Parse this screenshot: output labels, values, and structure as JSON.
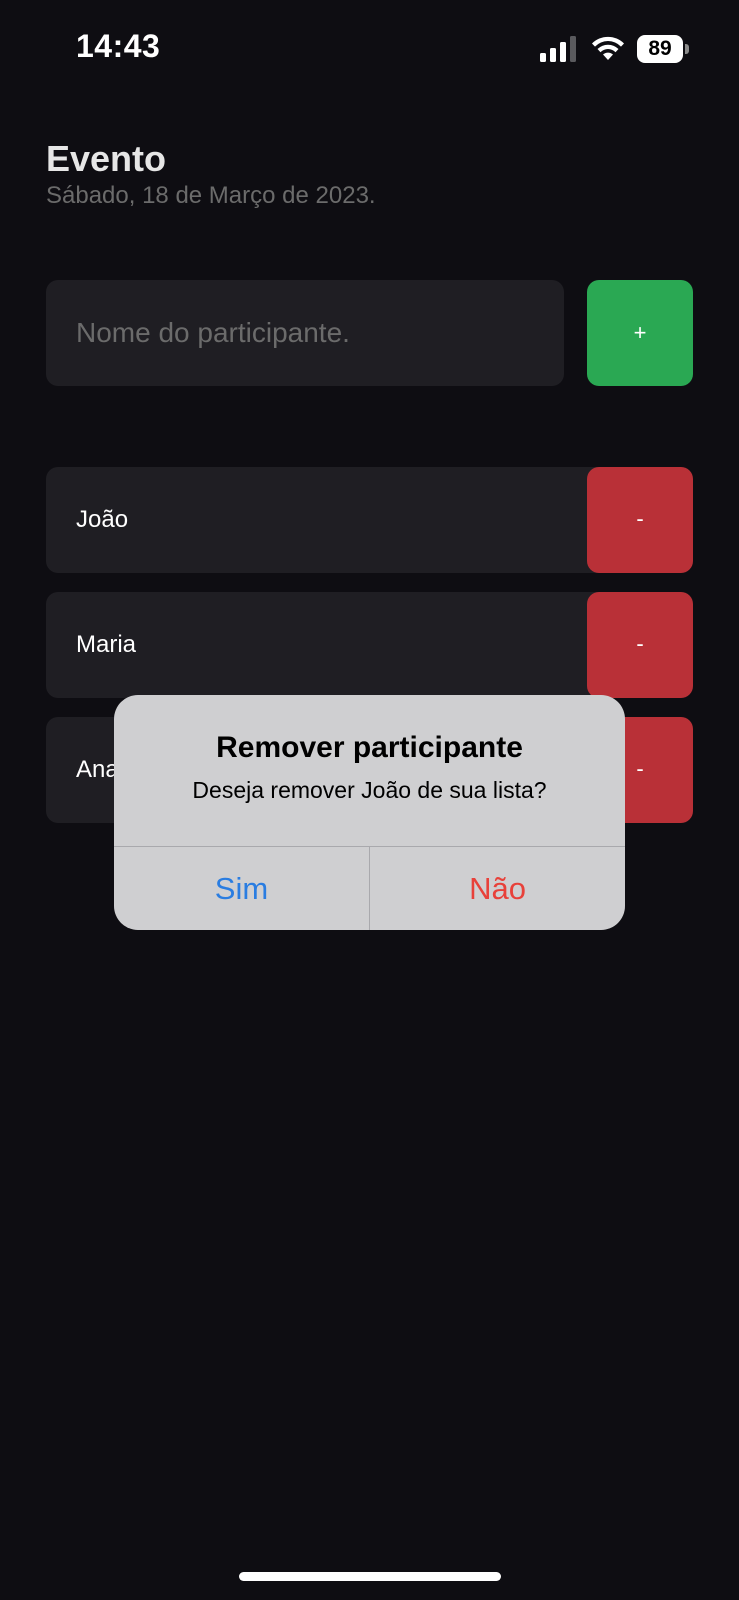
{
  "status_bar": {
    "time": "14:43",
    "battery": "89",
    "icons": [
      "signal-icon",
      "wifi-icon",
      "battery-icon"
    ]
  },
  "header": {
    "title": "Evento",
    "subtitle": "Sábado, 18 de Março de 2023."
  },
  "form": {
    "placeholder": "Nome do participante.",
    "value": "",
    "add_label": "+"
  },
  "participants": [
    {
      "name": "João",
      "remove_label": "-"
    },
    {
      "name": "Maria",
      "remove_label": "-"
    },
    {
      "name": "Ana",
      "remove_label": "-"
    }
  ],
  "alert": {
    "title": "Remover participante",
    "message": "Deseja remover João de sua lista?",
    "confirm_label": "Sim",
    "cancel_label": "Não"
  },
  "colors": {
    "background": "#0e0d12",
    "surface": "#1f1e23",
    "add": "#2aa853",
    "remove": "#b93037",
    "alert_confirm": "#2a7de1",
    "alert_cancel": "#e8413a"
  }
}
